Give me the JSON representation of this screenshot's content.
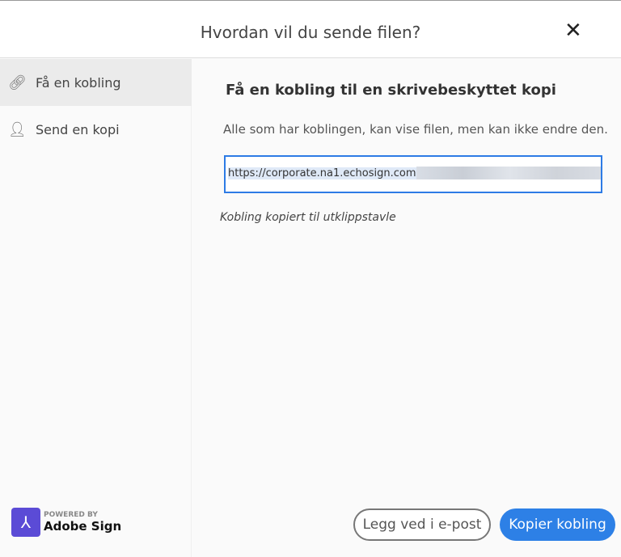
{
  "header": {
    "title": "Hvordan vil du sende filen?",
    "close_icon": "close-icon"
  },
  "sidebar": {
    "items": [
      {
        "label": "Få en kobling",
        "icon": "link-icon",
        "active": true
      },
      {
        "label": "Send en kopi",
        "icon": "add-user-icon",
        "active": false
      }
    ]
  },
  "main": {
    "heading": "Få en kobling til en skrivebeskyttet kopi",
    "description": "Alle som har koblingen, kan vise filen, men kan ikke endre den.",
    "url_value": "https://corporate.na1.echosign.com",
    "status": "Kobling kopiert til utklippstavle"
  },
  "branding": {
    "powered_by": "POWERED BY",
    "product": "Adobe Sign"
  },
  "buttons": {
    "email": "Legg ved i e-post",
    "copy": "Kopier kobling"
  },
  "colors": {
    "accent": "#2d80e6",
    "logo": "#5b4bd6"
  }
}
